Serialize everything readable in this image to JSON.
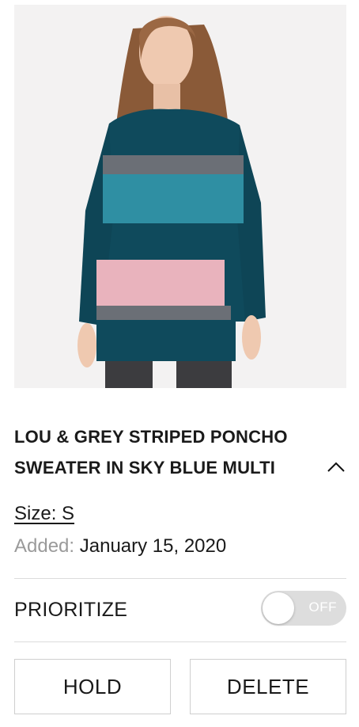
{
  "product": {
    "title_line1": "LOU & GREY STRIPED PONCHO",
    "title_line2": "SWEATER IN SKY BLUE MULTI",
    "size": "Size: S",
    "added_label": "Added:",
    "added_date": "January 15, 2020",
    "collapse_icon": "chevron-up-icon"
  },
  "prioritize": {
    "label": "PRIORITIZE",
    "toggle_state": "OFF"
  },
  "actions": {
    "hold_label": "HOLD",
    "delete_label": "DELETE"
  },
  "colors": {
    "sweater_teal": "#0f4a5c",
    "stripe_blue": "#2f8fa3",
    "stripe_grey": "#6b6f76",
    "stripe_pink": "#e9b3bd",
    "toggle_off": "#dddddd",
    "border": "#cfcfcf"
  }
}
